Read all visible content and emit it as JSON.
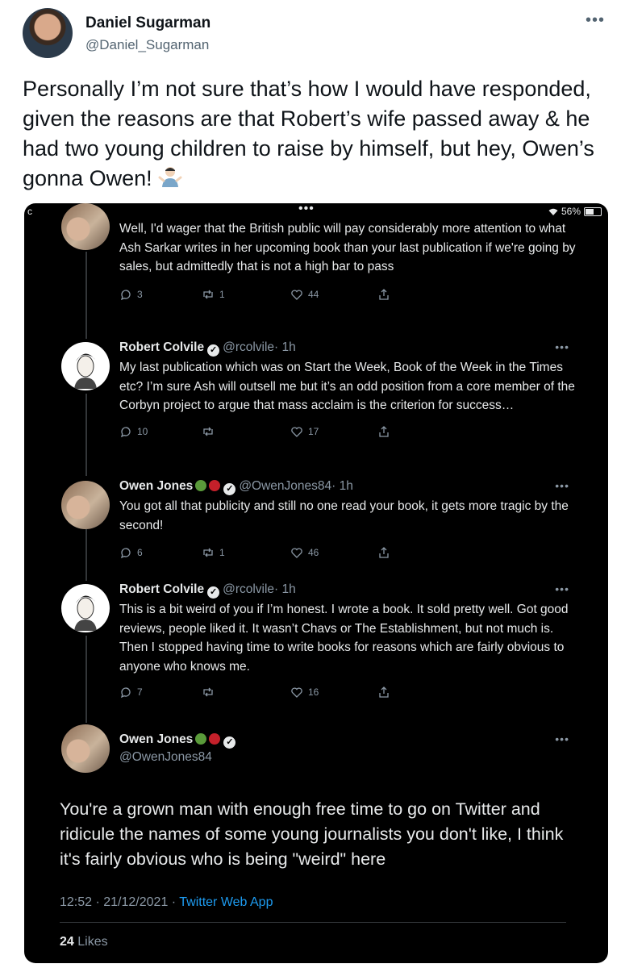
{
  "outer": {
    "name": "Daniel Sugarman",
    "handle": "@Daniel_Sugarman",
    "more": "•••",
    "text": "Personally I’m not sure that’s how I would have responded, given the reasons are that Robert’s wife passed away & he had two young children to raise by himself, but hey, Owen’s gonna Owen!"
  },
  "screenshot": {
    "status": {
      "left": "c",
      "dots": "•••",
      "battery": "56%"
    },
    "tweets": [
      {
        "text": "Well, I'd wager that the British public will pay considerably more attention to what Ash Sarkar writes in her upcoming book than your last publication if we're going by sales, but admittedly that is not a high bar to pass",
        "replies": "3",
        "retweets": "1",
        "likes": "44"
      },
      {
        "name": "Robert Colvile",
        "handle": "@rcolvile",
        "time": "· 1h",
        "more": "•••",
        "text": "My last publication which was on Start the Week, Book of the Week in the Times etc? I’m sure Ash will outsell me but it’s an odd position from a core member of the Corbyn project to argue that mass acclaim is the criterion for success…",
        "replies": "10",
        "retweets": "",
        "likes": "17"
      },
      {
        "name": "Owen Jones",
        "handle": "@OwenJones84",
        "time": "· 1h",
        "more": "•••",
        "text": "You got all that publicity and still no one read your book, it gets more tragic by the second!",
        "replies": "6",
        "retweets": "1",
        "likes": "46"
      },
      {
        "name": "Robert Colvile",
        "handle": "@rcolvile",
        "time": "· 1h",
        "more": "•••",
        "text": "This is a bit weird of you if I’m honest. I wrote a book. It sold pretty well. Got good reviews, people liked it. It wasn’t Chavs or The Establishment, but not much is. Then I stopped having time to write books for reasons which are fairly obvious to anyone who knows me.",
        "replies": "7",
        "retweets": "",
        "likes": "16"
      }
    ],
    "main": {
      "name": "Owen Jones",
      "handle": "@OwenJones84",
      "more": "•••",
      "text": "You're a grown man with enough free time to go on Twitter and ridicule the names of some young journalists you don't like, I think it's fairly obvious who is being \"weird\" here",
      "time": "12:52 · 21/12/2021 ·",
      "app": "Twitter Web App",
      "likes_count": "24",
      "likes_label": "Likes"
    }
  },
  "colors": {
    "accent": "#1d9bf0",
    "dark_bg": "#000000",
    "muted": "#8b98a5"
  }
}
